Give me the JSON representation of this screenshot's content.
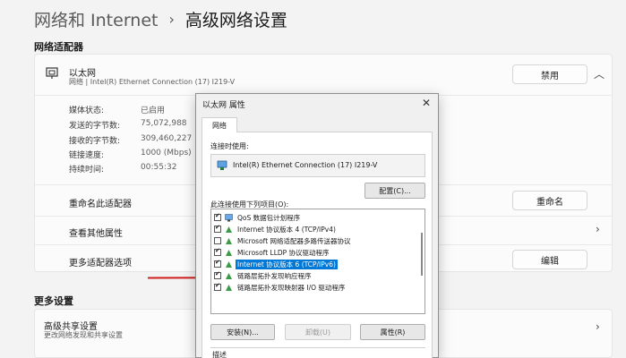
{
  "breadcrumb": {
    "parent": "网络和 Internet",
    "separator": "›",
    "current": "高级网络设置"
  },
  "adapters_section": {
    "heading": "网络适配器"
  },
  "ethernet": {
    "name": "以太网",
    "description": "网络 | Intel(R) Ethernet Connection (17) I219-V",
    "disable_label": "禁用",
    "properties": [
      {
        "label": "媒体状态:",
        "value": "已启用"
      },
      {
        "label": "发送的字节数:",
        "value": "75,072,988"
      },
      {
        "label": "接收的字节数:",
        "value": "309,460,227"
      },
      {
        "label": "链接速度:",
        "value": "1000 (Mbps)"
      },
      {
        "label": "持续时间:",
        "value": "00:55:32"
      }
    ],
    "rows": {
      "rename": {
        "label": "重命名此适配器",
        "button": "重命名"
      },
      "view": {
        "label": "查看其他属性"
      },
      "more": {
        "label": "更多适配器选项",
        "button": "编辑"
      }
    }
  },
  "more_section": {
    "heading": "更多设置"
  },
  "sharing": {
    "title": "高级共享设置",
    "subtitle": "更改网络发现和共享设置"
  },
  "dialog": {
    "title": "以太网 属性",
    "close": "✕",
    "tab": "网络",
    "connect_using_label": "连接时使用:",
    "adapter_name": "Intel(R) Ethernet Connection (17) I219-V",
    "configure_label": "配置(C)...",
    "items_label": "此连接使用下列项目(O):",
    "items": [
      {
        "label": "QoS 数据包计划程序",
        "checked": true,
        "selected": false
      },
      {
        "label": "Internet 协议版本 4 (TCP/IPv4)",
        "checked": true,
        "selected": false
      },
      {
        "label": "Microsoft 网络适配器多路传送器协议",
        "checked": false,
        "selected": false
      },
      {
        "label": "Microsoft LLDP 协议驱动程序",
        "checked": true,
        "selected": false
      },
      {
        "label": "Internet 协议版本 6 (TCP/IPv6)",
        "checked": true,
        "selected": true
      },
      {
        "label": "链路层拓扑发现响应程序",
        "checked": true,
        "selected": false
      },
      {
        "label": "链路层拓扑发现映射器 I/O 驱动程序",
        "checked": true,
        "selected": false
      }
    ],
    "install_label": "安装(N)...",
    "uninstall_label": "卸载(U)",
    "properties_label": "属性(R)",
    "description_label": "描述"
  },
  "colors": {
    "accent": "#0078d7",
    "annotation_line": "#d01f1f"
  }
}
